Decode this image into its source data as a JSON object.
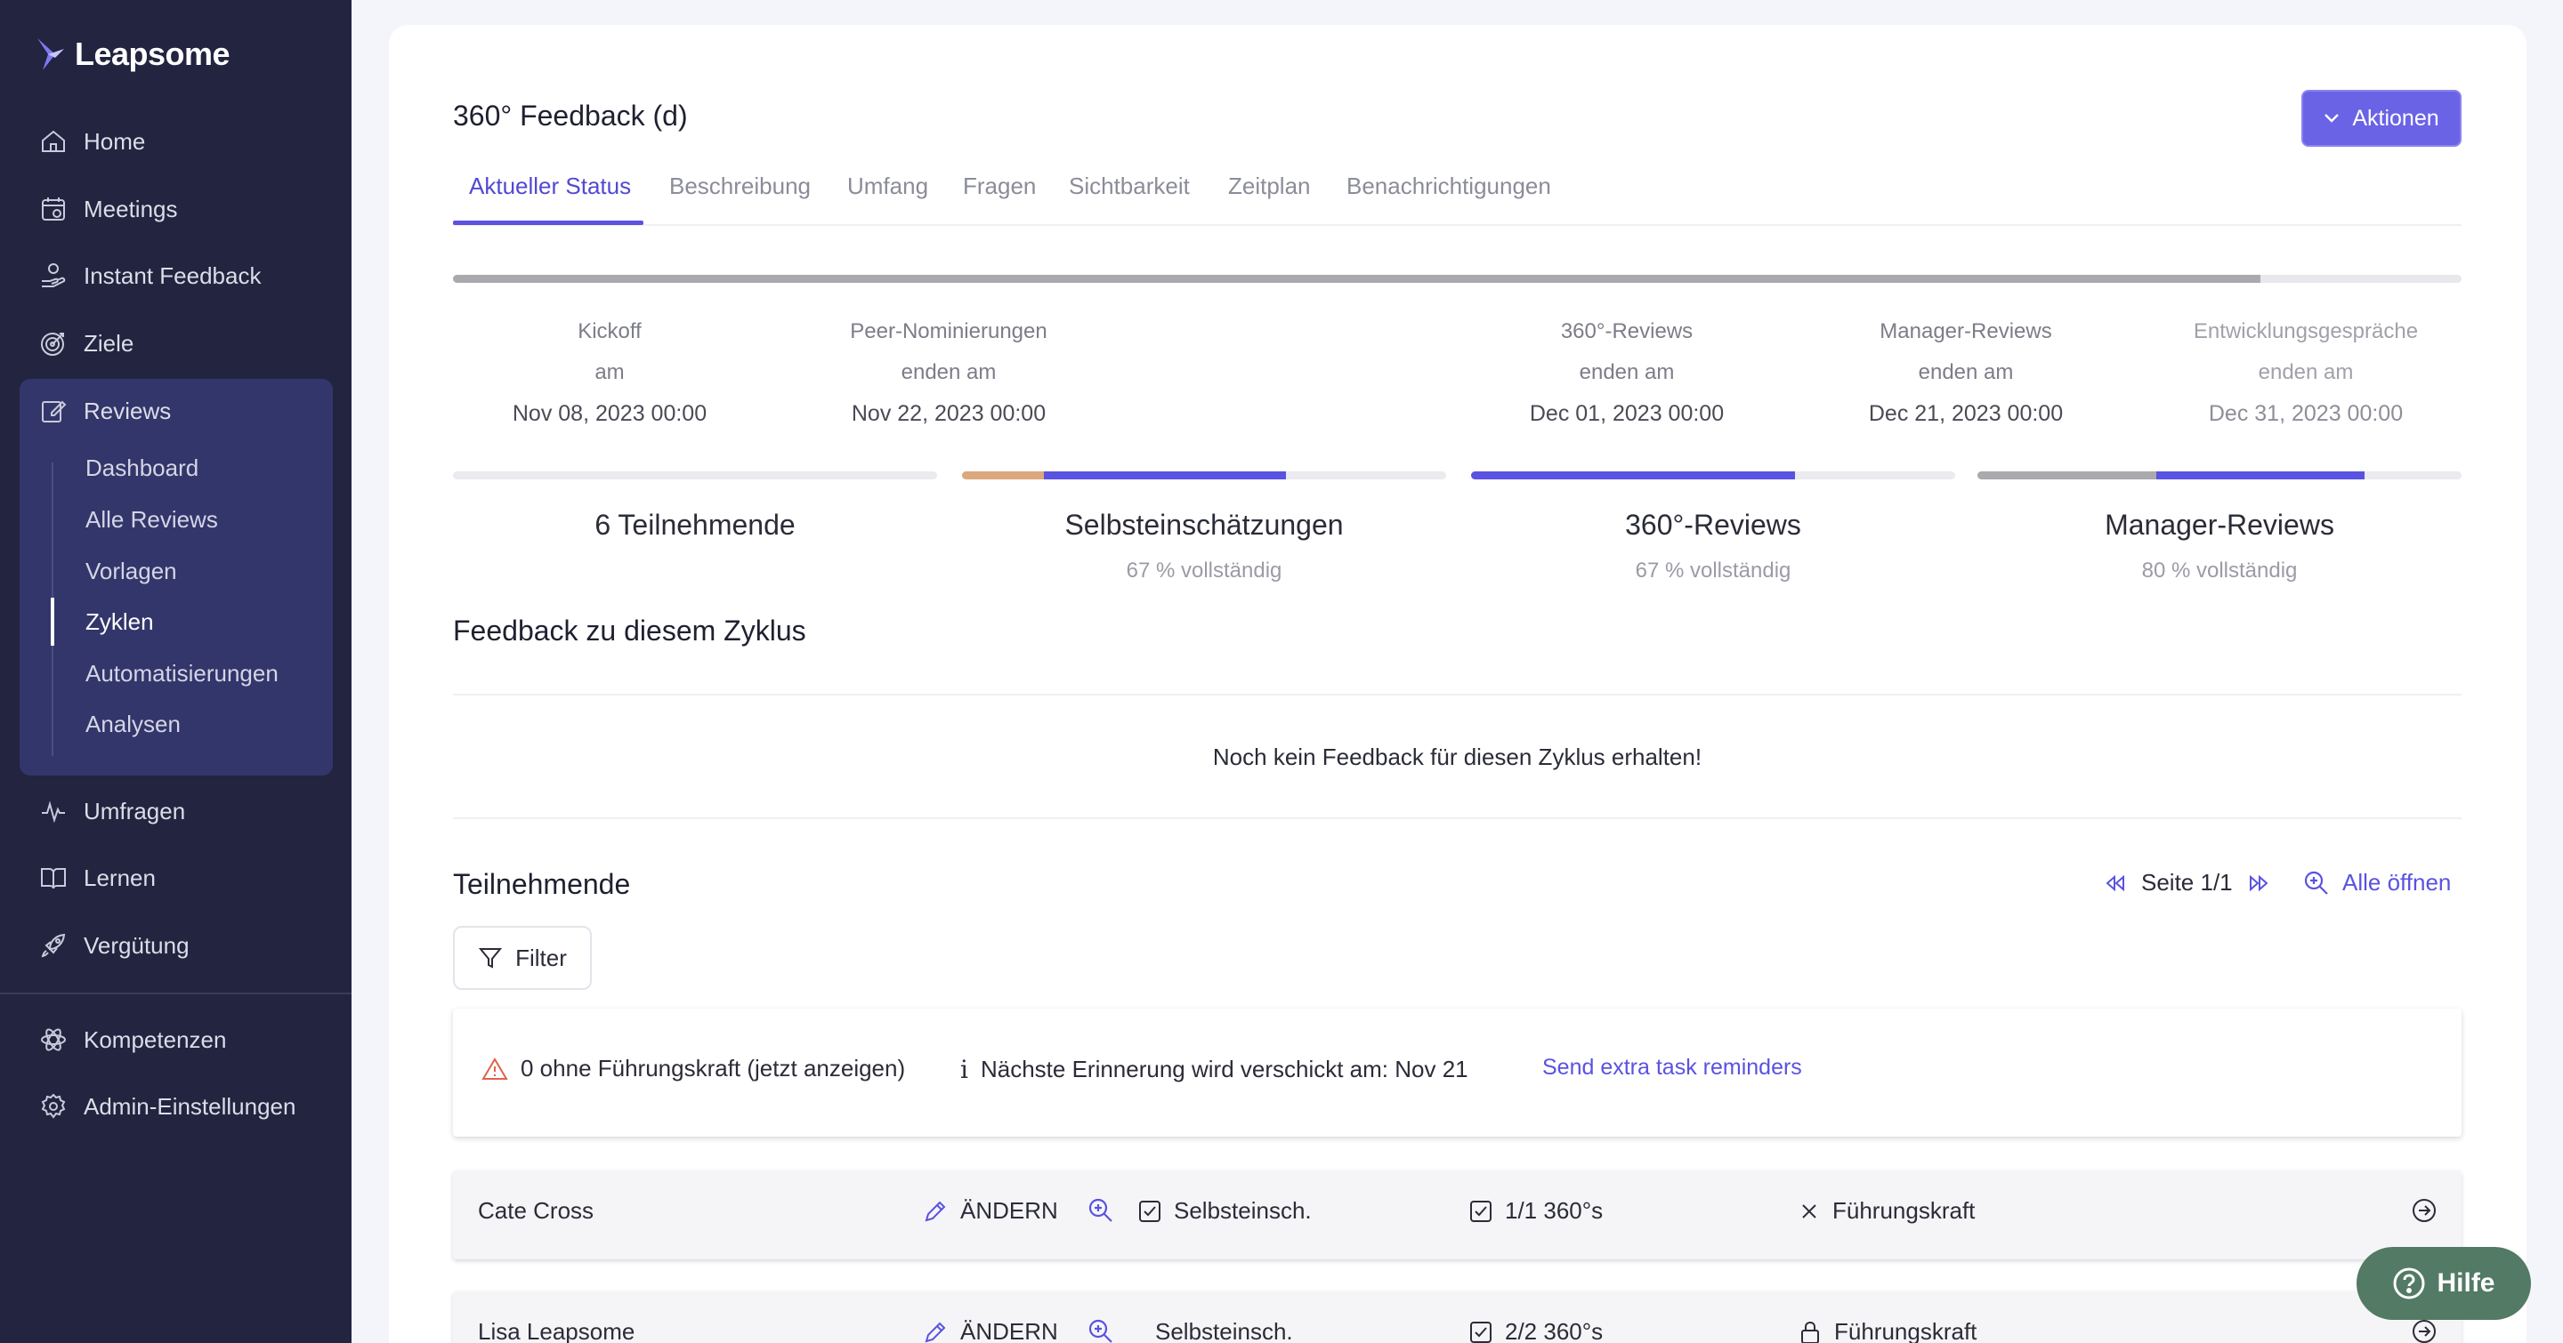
{
  "app": {
    "brand": "Leapsome"
  },
  "sidebar": {
    "items": [
      {
        "label": "Home",
        "icon": "home-icon"
      },
      {
        "label": "Meetings",
        "icon": "calendar-icon"
      },
      {
        "label": "Instant Feedback",
        "icon": "feedback-hand-icon"
      },
      {
        "label": "Ziele",
        "icon": "target-icon"
      },
      {
        "label": "Reviews",
        "icon": "edit-icon"
      },
      {
        "label": "Umfragen",
        "icon": "pulse-icon"
      },
      {
        "label": "Lernen",
        "icon": "book-icon"
      },
      {
        "label": "Vergütung",
        "icon": "rocket-icon"
      },
      {
        "label": "Kompetenzen",
        "icon": "atom-icon"
      },
      {
        "label": "Admin-Einstellungen",
        "icon": "gear-icon"
      }
    ],
    "reviews_sub": [
      "Dashboard",
      "Alle Reviews",
      "Vorlagen",
      "Zyklen",
      "Automatisierungen",
      "Analysen"
    ],
    "active_sub": "Zyklen"
  },
  "page": {
    "title": "360° Feedback (d)",
    "actions_label": "Aktionen",
    "tabs": [
      "Aktueller Status",
      "Beschreibung",
      "Umfang",
      "Fragen",
      "Sichtbarkeit",
      "Zeitplan",
      "Benachrichtigungen"
    ],
    "timeline_progress": 0.9
  },
  "milestones": [
    {
      "name": "Kickoff",
      "sub": "am",
      "date": "Nov 08, 2023 00:00"
    },
    {
      "name": "Peer-Nominierungen",
      "sub": "enden am",
      "date": "Nov 22, 2023 00:00"
    },
    {
      "name": "360°-Reviews",
      "sub": "enden am",
      "date": "Dec 01, 2023 00:00"
    },
    {
      "name": "Manager-Reviews",
      "sub": "enden am",
      "date": "Dec 21, 2023 00:00"
    },
    {
      "name": "Entwicklungsgespräche",
      "sub": "enden am",
      "date": "Dec 31, 2023 00:00"
    }
  ],
  "stats": [
    {
      "title": "6 Teilnehmende",
      "sub": ""
    },
    {
      "title": "Selbsteinschätzungen",
      "sub": "67 % vollständig",
      "progress": 0.67
    },
    {
      "title": "360°-Reviews",
      "sub": "67 % vollständig",
      "progress": 0.67
    },
    {
      "title": "Manager-Reviews",
      "sub": "80 % vollständig",
      "progress": 0.8
    }
  ],
  "colors": {
    "accent": "#5a52e0",
    "orange": "#dba77d",
    "gray": "#a9a9ae",
    "sidebar": "#222440",
    "help": "#527a64"
  },
  "feedback": {
    "heading": "Feedback zu diesem Zyklus",
    "empty": "Noch kein Feedback für diesen Zyklus erhalten!"
  },
  "participants": {
    "heading": "Teilnehmende",
    "page_label": "Seite 1/1",
    "open_all": "Alle öffnen",
    "filter": "Filter",
    "warning": "0 ohne Führungskraft (jetzt anzeigen)",
    "info": "Nächste Erinnerung wird verschickt am: Nov 21",
    "reminder_link": "Send extra task reminders",
    "rows": [
      {
        "name": "Cate Cross",
        "edit": "ÄNDERN",
        "self": "Selbsteinsch.",
        "reviews": "1/1 360°s",
        "manager": "Führungskraft"
      },
      {
        "name": "Lisa Leapsome",
        "edit": "ÄNDERN",
        "self": "Selbsteinsch.",
        "reviews": "2/2 360°s",
        "manager": "Führungskraft"
      }
    ]
  },
  "help": {
    "label": "Hilfe"
  }
}
